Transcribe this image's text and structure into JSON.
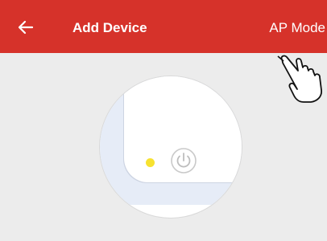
{
  "header": {
    "title": "Add Device",
    "mode_label": "AP Mode",
    "background_color": "#d6322a"
  },
  "icons": {
    "back": "arrow-left-icon",
    "pointer": "pointing-hand-icon",
    "led": "status-led-icon",
    "power": "power-icon"
  },
  "colors": {
    "led": "#f7e230",
    "page_background": "#ececec"
  }
}
